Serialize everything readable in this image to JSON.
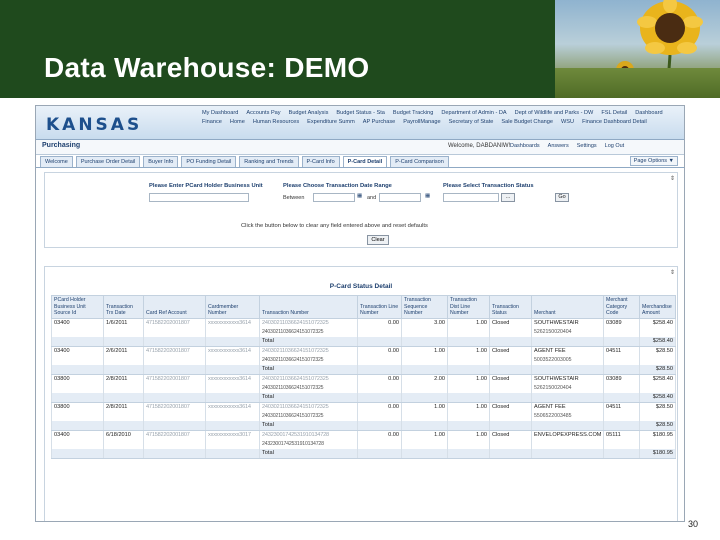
{
  "slide": {
    "title": "Data Warehouse:  DEMO",
    "page_number": "30"
  },
  "app": {
    "logo": "KANSAS",
    "topnav": [
      "My Dashboard",
      "Accounts Pay",
      "Budget Analysis",
      "Budget Status - Sta",
      "Budget Tracking",
      "Department of Admin - DA",
      "Dept of Wildlife and Parks - DW",
      "FSL Detail",
      "Dashboard",
      "Finance",
      "Home",
      "Human Resources",
      "Expenditure Summ",
      "AP Purchase",
      "PayrollManage",
      "Secretary of State",
      "Sale Budget Change",
      "WSU",
      "Finance Dashboard Detail"
    ],
    "page": "Purchasing",
    "welcome": "Welcome, DABDANIW!",
    "header_links": [
      "Dashboards",
      "Answers",
      "Settings",
      "Log Out"
    ],
    "tabs": [
      "Welcome",
      "Purchase Order Detail",
      "Buyer Info",
      "PO Funding Detail",
      "Ranking and Trends",
      "P-Card Info",
      "P-Card Detail",
      "P-Card Comparison"
    ],
    "page_options": "Page Options ▼"
  },
  "prompts": {
    "bu_label": "Please Enter PCard Holder Business Unit",
    "date_label": "Please Choose Transaction Date Range",
    "date_between": "Between",
    "date_and": "and",
    "status_label": "Please Select Transaction Status",
    "dots_btn": "...",
    "go_btn": "Go",
    "hint": "Click the button below to clear any field entered above and reset defaults",
    "clear_btn": "Clear"
  },
  "report": {
    "title": "P-Card Status Detail",
    "headers": [
      "PCard Holder Business Unit Source Id",
      "Transaction Trx Date",
      "Card Ref Account",
      "Cardmember Number",
      "Transaction Number",
      "Transaction Line Number",
      "Transaction Sequence Number",
      "Transaction Dist Line Number",
      "Transaction Status",
      "Merchant",
      "Merchant Category Code",
      "Merchandise Amount"
    ],
    "rows": [
      {
        "bu": "03400",
        "date": "1/6/2011",
        "card": "471582202001807",
        "member": "xxxxxxxxxxxx3614",
        "trx": "24030211036624151072325",
        "line": "0.00",
        "seq": "3.00",
        "dist": "1.00",
        "status": "Closed",
        "merchant": "SOUTHWESTAIR",
        "merchant2": "5262150020404",
        "mcc": "03089",
        "amount": "$258.40",
        "sub_trx": "24030211036624151072325",
        "total_label": "Total",
        "total": "$258.40"
      },
      {
        "bu": "03400",
        "date": "2/6/2011",
        "card": "471582202001807",
        "member": "xxxxxxxxxxxx3614",
        "trx": "24030211036624151072325",
        "line": "0.00",
        "seq": "1.00",
        "dist": "1.00",
        "status": "Closed",
        "merchant": "AGENT FEE",
        "merchant2": "5003522003005",
        "mcc": "04511",
        "amount": "$28.50",
        "sub_trx": "24030211036624151072325",
        "total_label": "Total",
        "total": "$28.50"
      },
      {
        "bu": "03800",
        "date": "2/8/2011",
        "card": "471582202001807",
        "member": "xxxxxxxxxxxx3614",
        "trx": "24030211036624151072325",
        "line": "0.00",
        "seq": "2.00",
        "dist": "1.00",
        "status": "Closed",
        "merchant": "SOUTHWESTAIR",
        "merchant2": "5262150020404",
        "mcc": "03089",
        "amount": "$258.40",
        "sub_trx": "24030211036624151072325",
        "total_label": "Total",
        "total": "$258.40"
      },
      {
        "bu": "03800",
        "date": "2/8/2011",
        "card": "471582202001807",
        "member": "xxxxxxxxxxxx3614",
        "trx": "24030211036624151072325",
        "line": "0.00",
        "seq": "1.00",
        "dist": "1.00",
        "status": "Closed",
        "merchant": "AGENT FEE",
        "merchant2": "5506522003485",
        "mcc": "04511",
        "amount": "$28.50",
        "sub_trx": "24030211036624151072325",
        "total_label": "Total",
        "total": "$28.50"
      },
      {
        "bu": "03400",
        "date": "6/18/2010",
        "card": "471582202001807",
        "member": "xxxxxxxxxxxx3017",
        "trx": "24323001742531910134728",
        "line": "0.00",
        "seq": "1.00",
        "dist": "1.00",
        "status": "Closed",
        "merchant": "ENVELOPEXPRESS.COM",
        "merchant2": "",
        "mcc": "05111",
        "amount": "$180.95",
        "sub_trx": "24323001742531910134728",
        "total_label": "Total",
        "total": "$180.95"
      }
    ]
  }
}
